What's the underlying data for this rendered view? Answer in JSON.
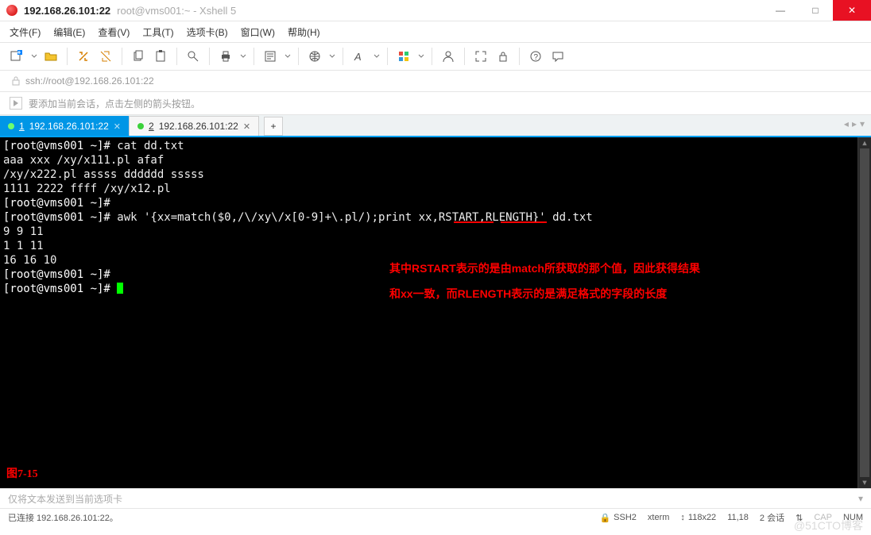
{
  "title": {
    "main": "192.168.26.101:22",
    "sub": "root@vms001:~ - Xshell 5"
  },
  "menu": {
    "file": "文件(F)",
    "edit": "编辑(E)",
    "view": "查看(V)",
    "tools": "工具(T)",
    "tabs": "选项卡(B)",
    "window": "窗口(W)",
    "help": "帮助(H)"
  },
  "address": {
    "url": "ssh://root@192.168.26.101:22"
  },
  "hint": {
    "text": "要添加当前会话，点击左侧的箭头按钮。"
  },
  "tabs": {
    "items": [
      {
        "num": "1",
        "label": "192.168.26.101:22",
        "active": true
      },
      {
        "num": "2",
        "label": "192.168.26.101:22",
        "active": false
      }
    ],
    "add": "+"
  },
  "terminal": {
    "lines": [
      {
        "prompt": "[root@vms001 ~]#",
        "cmd": " cat dd.txt"
      },
      {
        "plain": "aaa xxx /xy/x111.pl afaf"
      },
      {
        "plain": "/xy/x222.pl assss dddddd sssss"
      },
      {
        "plain": "1111 2222 ffff /xy/x12.pl"
      },
      {
        "prompt": "[root@vms001 ~]#",
        "cmd": ""
      },
      {
        "prompt": "[root@vms001 ~]#",
        "cmd": " awk '{xx=match($0,/\\/xy\\/x[0-9]+\\.pl/);print xx,RSTART,RLENGTH}' dd.txt"
      },
      {
        "plain": "9 9 11"
      },
      {
        "plain": "1 1 11"
      },
      {
        "plain": "16 16 10"
      },
      {
        "prompt": "[root@vms001 ~]#",
        "cmd": ""
      },
      {
        "prompt": "[root@vms001 ~]#",
        "cmd": " ",
        "cursor": true
      }
    ],
    "annotation": {
      "l1": "其中RSTART表示的是由match所获取的那个值，因此获得结果",
      "l2": "和xx一致，而RLENGTH表示的是满足格式的字段的长度"
    },
    "figure_label": "图7-15"
  },
  "sendbar": {
    "text": "仅将文本发送到当前选项卡"
  },
  "status": {
    "conn": "已连接 192.168.26.101:22。",
    "proto": "SSH2",
    "termtype": "xterm",
    "size": "118x22",
    "pos": "11,18",
    "sessions": "2 会话",
    "cap": "CAP",
    "num": "NUM",
    "arrows": "⇅",
    "resize": "↕"
  },
  "watermark": "@51CTO博客",
  "icons": {
    "lock": "lock",
    "arrow_right": "→",
    "plus": "+",
    "min": "—",
    "max": "□",
    "close": "✕",
    "chev_l": "◂",
    "chev_r": "▸",
    "chev_d": "▾"
  }
}
